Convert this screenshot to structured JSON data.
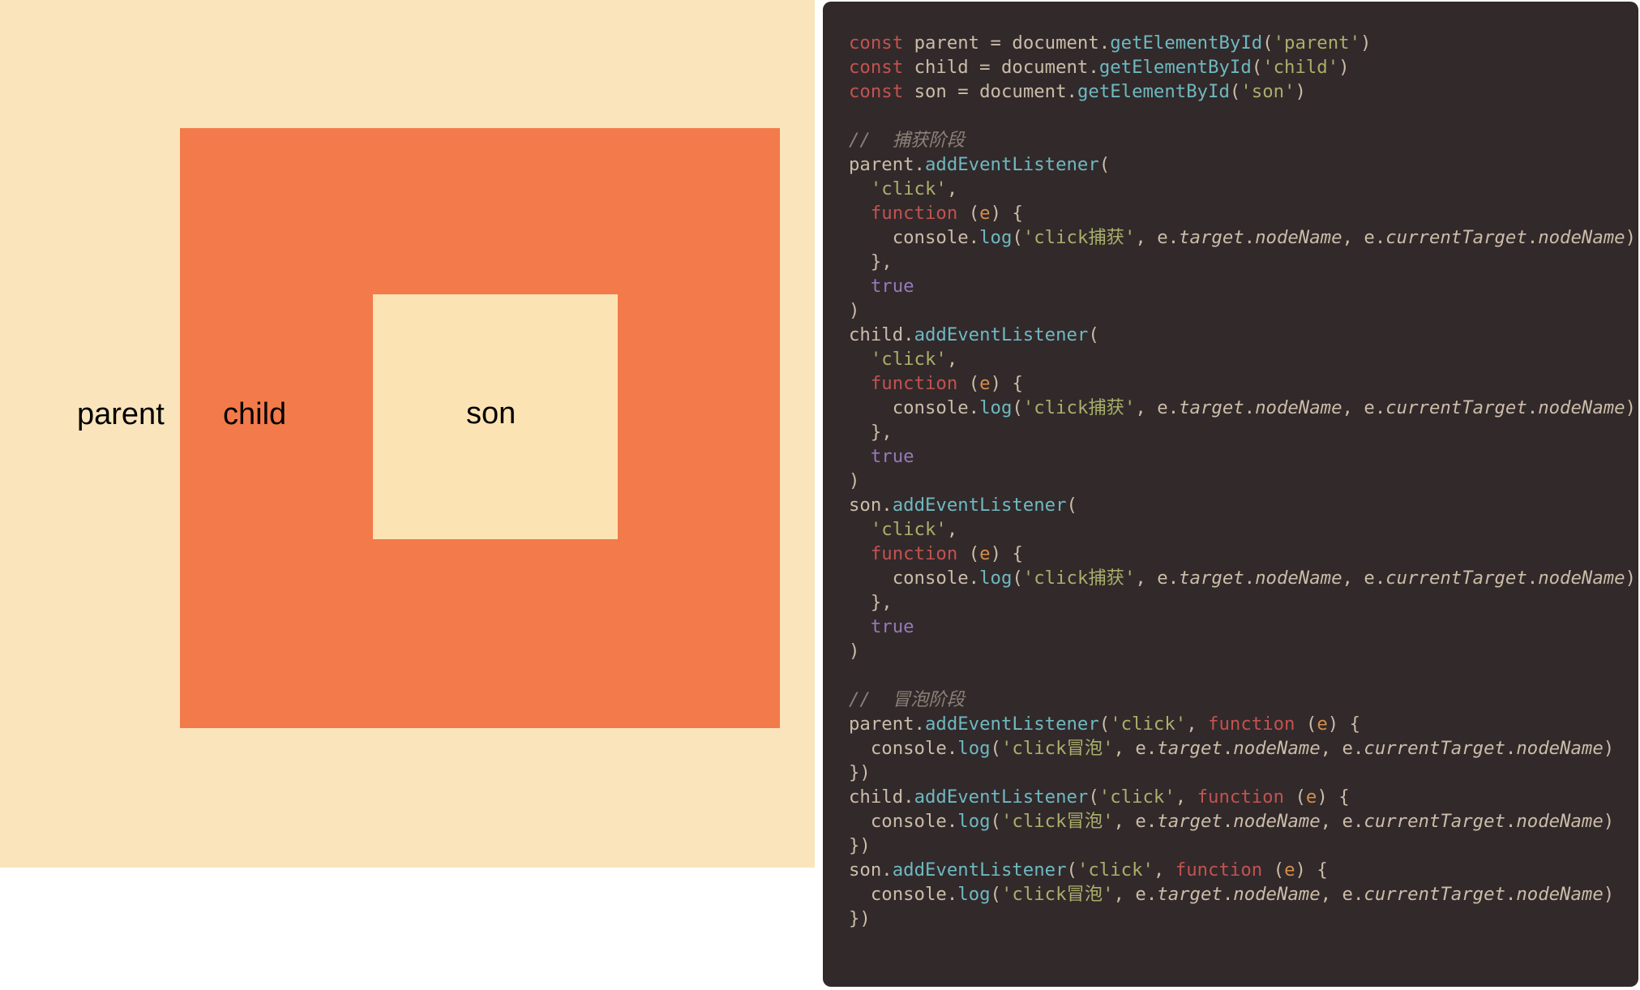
{
  "diagram": {
    "parent_label": "parent",
    "child_label": "child",
    "son_label": "son"
  },
  "code": {
    "l1": {
      "kw": "const",
      "var": "parent",
      "eq": " = ",
      "obj": "document",
      "dot": ".",
      "method": "getElementById",
      "op": "(",
      "str": "'parent'",
      "cp": ")"
    },
    "l2": {
      "kw": "const",
      "var": "child",
      "eq": " = ",
      "obj": "document",
      "dot": ".",
      "method": "getElementById",
      "op": "(",
      "str": "'child'",
      "cp": ")"
    },
    "l3": {
      "kw": "const",
      "var": "son",
      "eq": " = ",
      "obj": "document",
      "dot": ".",
      "method": "getElementById",
      "op": "(",
      "str": "'son'",
      "cp": ")"
    },
    "comment1": "//  捕获阶段",
    "listener_method": "addEventListener",
    "click_str": "'click'",
    "function_kw": "function",
    "param_e": "e",
    "paren_open": "(",
    "paren_close": ")",
    "brace_open": " {",
    "brace_close": "}",
    "comma": ",",
    "true": "true",
    "console": "console",
    "log": "log",
    "capture_str": "'click捕获'",
    "bubble_str": "'click冒泡'",
    "target": "target",
    "nodeName": "nodeName",
    "currentTarget": "currentTarget",
    "comment2": "//  冒泡阶段",
    "vars": {
      "parent": "parent",
      "child": "child",
      "son": "son"
    },
    "close_paren_brace": "})",
    "indent2": "  ",
    "indent4": "    "
  }
}
